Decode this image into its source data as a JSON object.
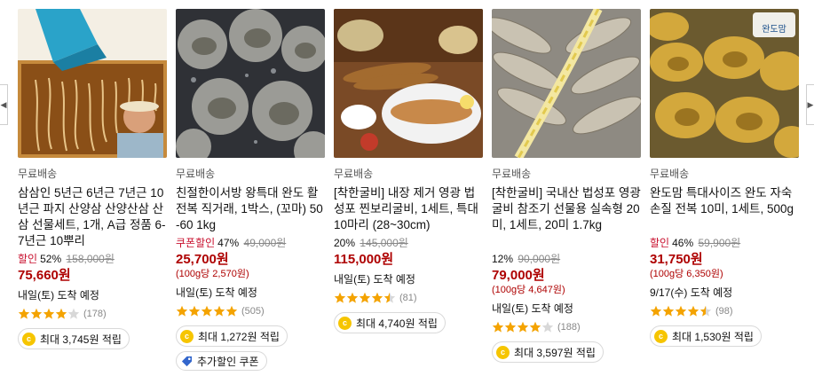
{
  "nav": {
    "prev_glyph": "◀",
    "next_glyph": "▶"
  },
  "colors": {
    "sale_price": "#ae0000",
    "discount_label": "#c8102e",
    "star": "#f4a300",
    "coin": "#f6c500"
  },
  "products": [
    {
      "image_icon": "ginseng-gift-set-image",
      "shipping": "무료배송",
      "title": "삼삼인 5년근 6년근 7년근 10년근 파지 산양삼 산양산삼 산삼 선물세트, 1개, A급 정품 6-7년근 10뿌리",
      "discount_label": "할인",
      "discount_rate": "52%",
      "original_price": "158,000원",
      "sale_price": "75,660원",
      "unit_price": "",
      "delivery": "내일(토) 도착 예정",
      "rating": 4.0,
      "review_count": "(178)",
      "reward": "최대 3,745원 적립",
      "coupon": ""
    },
    {
      "image_icon": "abalone-image",
      "shipping": "무료배송",
      "title": "친절한이서방 왕특대 완도 활 전복 직거래, 1박스, (꼬마) 50-60 1kg",
      "discount_label": "쿠폰할인",
      "discount_rate": "47%",
      "original_price": "49,000원",
      "sale_price": "25,700원",
      "unit_price": "(100g당 2,570원)",
      "delivery": "내일(토) 도착 예정",
      "rating": 5.0,
      "review_count": "(505)",
      "reward": "최대 1,272원 적립",
      "coupon": "추가할인 쿠폰"
    },
    {
      "image_icon": "grilled-fish-dish-image",
      "shipping": "무료배송",
      "title": "[착한굴비] 내장 제거 영광 법성포 찐보리굴비, 1세트, 특대 10마리 (28~30cm)",
      "discount_label": "",
      "discount_rate": "20%",
      "original_price": "145,000원",
      "sale_price": "115,000원",
      "unit_price": "",
      "delivery": "내일(토) 도착 예정",
      "rating": 4.5,
      "review_count": "(81)",
      "reward": "최대 4,740원 적립",
      "coupon": ""
    },
    {
      "image_icon": "dried-yellow-croaker-image",
      "shipping": "무료배송",
      "title": "[착한굴비] 국내산 법성포 영광굴비 참조기 선물용 실속형 20미, 1세트, 20미 1.7kg",
      "discount_label": "",
      "discount_rate": "12%",
      "original_price": "90,000원",
      "sale_price": "79,000원",
      "unit_price": "(100g당 4,647원)",
      "delivery": "내일(토) 도착 예정",
      "rating": 4.0,
      "review_count": "(188)",
      "reward": "최대 3,597원 적립",
      "coupon": ""
    },
    {
      "image_icon": "wando-abalone-image",
      "brand_badge": "완도맘",
      "shipping": "무료배송",
      "title": "완도맘 특대사이즈 완도 자숙 손질 전복 10미, 1세트, 500g",
      "discount_label": "할인",
      "discount_rate": "46%",
      "original_price": "59,900원",
      "sale_price": "31,750원",
      "unit_price": "(100g당 6,350원)",
      "delivery": "9/17(수) 도착 예정",
      "rating": 4.5,
      "review_count": "(98)",
      "reward": "최대 1,530원 적립",
      "coupon": ""
    }
  ]
}
